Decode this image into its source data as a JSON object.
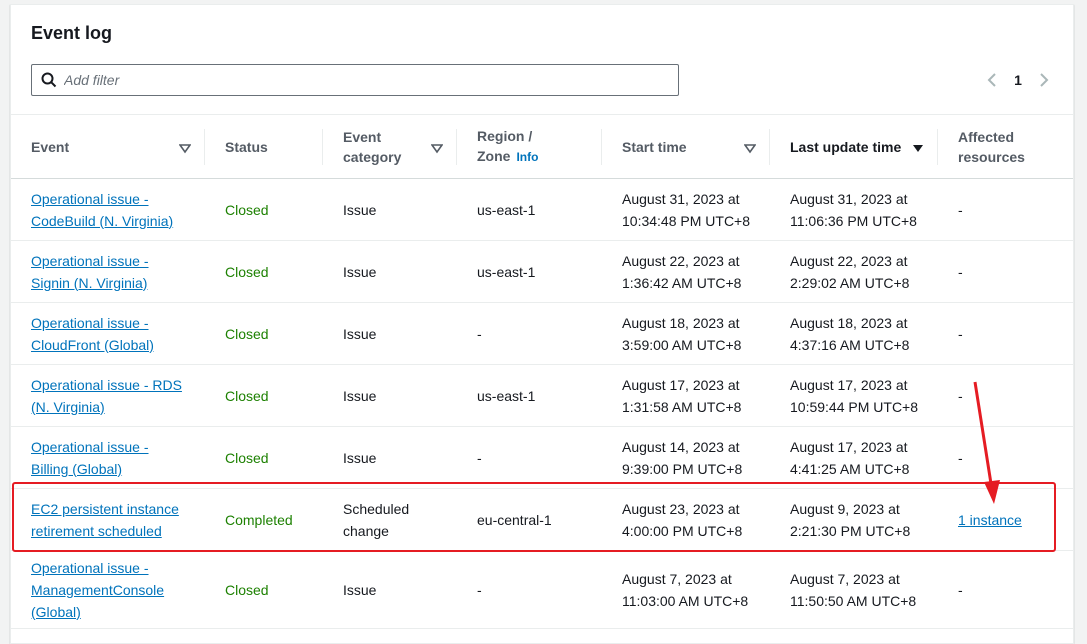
{
  "panel": {
    "title": "Event log"
  },
  "filter": {
    "placeholder": "Add filter"
  },
  "pagination": {
    "current_page": "1"
  },
  "columns": {
    "event": "Event",
    "status": "Status",
    "event_category_line1": "Event",
    "event_category_line2": "category",
    "region_line1": "Region /",
    "region_line2": "Zone",
    "region_info": "Info",
    "start_time": "Start time",
    "last_update_time": "Last update time",
    "affected_line1": "Affected",
    "affected_line2": "resources"
  },
  "rows": [
    {
      "event_l1": "Operational issue -",
      "event_l2": "CodeBuild (N. Virginia)",
      "status": "Closed",
      "category_l1": "Issue",
      "category_l2": "",
      "region": "us-east-1",
      "start_l1": "August 31, 2023 at",
      "start_l2": "10:34:48 PM UTC+8",
      "update_l1": "August 31, 2023 at",
      "update_l2": "11:06:36 PM UTC+8",
      "affected": "-"
    },
    {
      "event_l1": "Operational issue -",
      "event_l2": "Signin (N. Virginia)",
      "status": "Closed",
      "category_l1": "Issue",
      "category_l2": "",
      "region": "us-east-1",
      "start_l1": "August 22, 2023 at",
      "start_l2": "1:36:42 AM UTC+8",
      "update_l1": "August 22, 2023 at",
      "update_l2": "2:29:02 AM UTC+8",
      "affected": "-"
    },
    {
      "event_l1": "Operational issue -",
      "event_l2": "CloudFront (Global)",
      "status": "Closed",
      "category_l1": "Issue",
      "category_l2": "",
      "region": "-",
      "start_l1": "August 18, 2023 at",
      "start_l2": "3:59:00 AM UTC+8",
      "update_l1": "August 18, 2023 at",
      "update_l2": "4:37:16 AM UTC+8",
      "affected": "-"
    },
    {
      "event_l1": "Operational issue - RDS",
      "event_l2": "(N. Virginia)",
      "status": "Closed",
      "category_l1": "Issue",
      "category_l2": "",
      "region": "us-east-1",
      "start_l1": "August 17, 2023 at",
      "start_l2": "1:31:58 AM UTC+8",
      "update_l1": "August 17, 2023 at",
      "update_l2": "10:59:44 PM UTC+8",
      "affected": "-"
    },
    {
      "event_l1": "Operational issue -",
      "event_l2": "Billing (Global)",
      "status": "Closed",
      "category_l1": "Issue",
      "category_l2": "",
      "region": "-",
      "start_l1": "August 14, 2023 at",
      "start_l2": "9:39:00 PM UTC+8",
      "update_l1": "August 17, 2023 at",
      "update_l2": "4:41:25 AM UTC+8",
      "affected": "-"
    },
    {
      "event_l1": "EC2 persistent instance",
      "event_l2": "retirement scheduled",
      "status": "Completed",
      "category_l1": "Scheduled",
      "category_l2": "change",
      "region": "eu-central-1",
      "start_l1": "August 23, 2023 at",
      "start_l2": "4:00:00 PM UTC+8",
      "update_l1": "August 9, 2023 at",
      "update_l2": "2:21:30 PM UTC+8",
      "affected": "1 instance"
    },
    {
      "event_l1": "Operational issue -",
      "event_l2": "ManagementConsole",
      "event_l3": "(Global)",
      "status": "Closed",
      "category_l1": "Issue",
      "category_l2": "",
      "region": "-",
      "start_l1": "August 7, 2023 at",
      "start_l2": "11:03:00 AM UTC+8",
      "update_l1": "August 7, 2023 at",
      "update_l2": "11:50:50 AM UTC+8",
      "affected": "-"
    }
  ],
  "colors": {
    "link": "#0073bb",
    "status_closed": "#545b64",
    "status_completed": "#1d8102",
    "annotation": "#e51c23"
  },
  "icons": {
    "search": "search-icon",
    "prev": "chevron-left-icon",
    "next": "chevron-right-icon",
    "sort": "sort-caret-icon"
  }
}
